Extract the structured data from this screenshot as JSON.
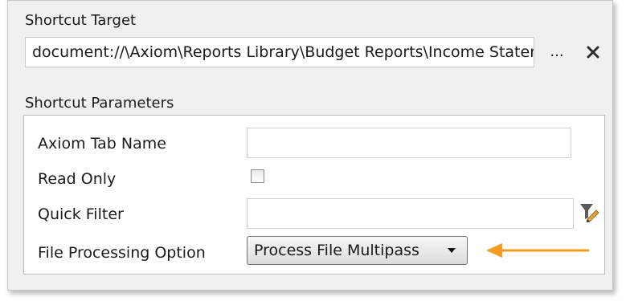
{
  "shortcut_target": {
    "label": "Shortcut Target",
    "value": "document://\\Axiom\\Reports Library\\Budget Reports\\Income Statement.xlsx",
    "browse_label": "...",
    "clear_icon": "close-icon"
  },
  "shortcut_parameters": {
    "label": "Shortcut Parameters",
    "axiom_tab_name": {
      "label": "Axiom Tab Name",
      "value": ""
    },
    "read_only": {
      "label": "Read Only",
      "checked": false
    },
    "quick_filter": {
      "label": "Quick Filter",
      "value": "",
      "icon": "filter-edit-icon"
    },
    "file_processing_option": {
      "label": "File Processing Option",
      "selected": "Process File Multipass"
    }
  },
  "colors": {
    "arrow": "#f39c1f"
  }
}
